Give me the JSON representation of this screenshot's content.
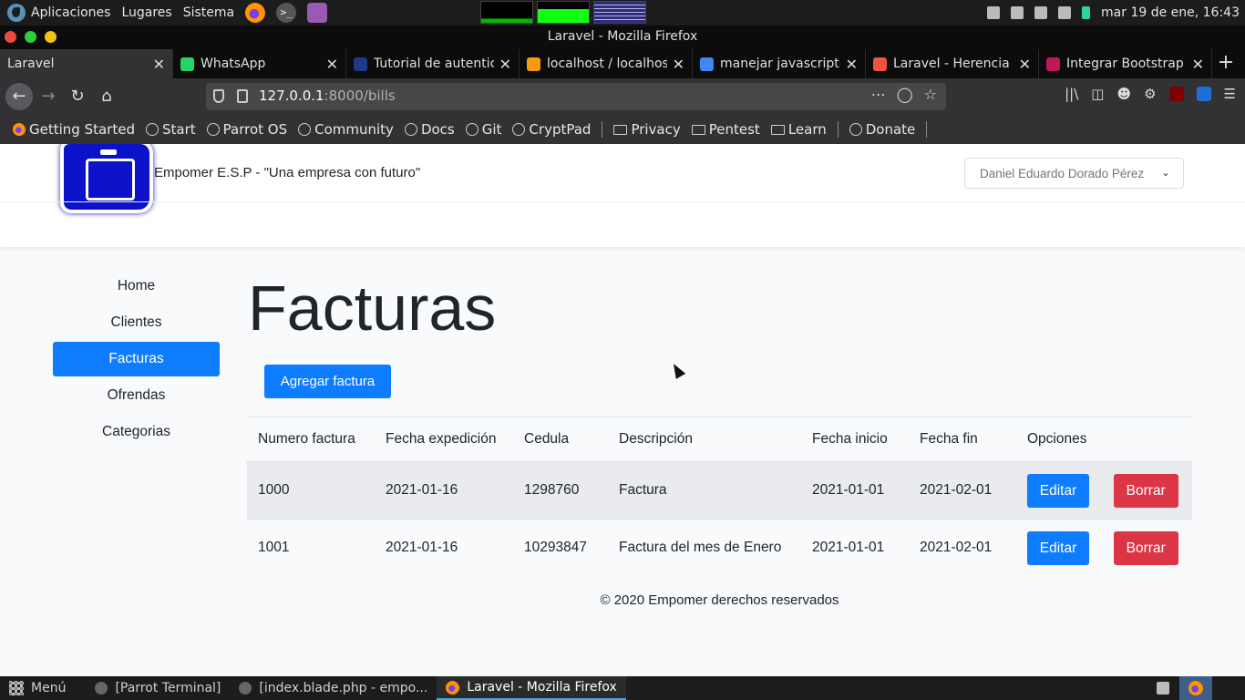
{
  "system_panel": {
    "menu_apps": "Aplicaciones",
    "menu_places": "Lugares",
    "menu_system": "Sistema",
    "clock": "mar 19 de ene, 16:43"
  },
  "window": {
    "title": "Laravel - Mozilla Firefox"
  },
  "tabs": [
    {
      "label": "Laravel",
      "icon": "no-favicon",
      "active": true
    },
    {
      "label": "WhatsApp",
      "icon": "whatsapp-icon",
      "color": "#25d366"
    },
    {
      "label": "Tutorial de autentic",
      "icon": "rocket-icon",
      "color": "#1e3a8a"
    },
    {
      "label": "localhost / localhost",
      "icon": "phpmyadmin-icon",
      "color": "#f89c0e"
    },
    {
      "label": "manejar javascript y",
      "icon": "google-icon",
      "color": "#4285f4"
    },
    {
      "label": "Laravel - Herencia d",
      "icon": "laravel-icon",
      "color": "#f05340"
    },
    {
      "label": "Integrar Bootstrap c",
      "icon": "bootstrap-icon",
      "color": "#c2185b"
    }
  ],
  "urlbar": {
    "host": "127.0.0.1",
    "path": ":8000/bills"
  },
  "bookmarks": [
    {
      "label": "Getting Started",
      "icon": "firefox-icon"
    },
    {
      "label": "Start",
      "icon": "globe-icon"
    },
    {
      "label": "Parrot OS",
      "icon": "globe-icon"
    },
    {
      "label": "Community",
      "icon": "globe-icon"
    },
    {
      "label": "Docs",
      "icon": "globe-icon"
    },
    {
      "label": "Git",
      "icon": "globe-icon"
    },
    {
      "label": "CryptPad",
      "icon": "globe-icon"
    },
    {
      "label": "Privacy",
      "icon": "folder-icon"
    },
    {
      "label": "Pentest",
      "icon": "folder-icon"
    },
    {
      "label": "Learn",
      "icon": "folder-icon"
    },
    {
      "label": "Donate",
      "icon": "globe-icon"
    }
  ],
  "header": {
    "brand": "Empomer E.S.P - \"Una empresa con futuro\"",
    "user_name": "Daniel Eduardo Dorado Pérez"
  },
  "sidebar": {
    "items": [
      {
        "label": "Home"
      },
      {
        "label": "Clientes"
      },
      {
        "label": "Facturas",
        "active": true
      },
      {
        "label": "Ofrendas"
      },
      {
        "label": "Categorias"
      }
    ]
  },
  "main": {
    "title": "Facturas",
    "add_button": "Agregar factura",
    "columns": [
      "Numero factura",
      "Fecha expedición",
      "Cedula",
      "Descripción",
      "Fecha inicio",
      "Fecha fin",
      "Opciones"
    ],
    "rows": [
      {
        "numero": "1000",
        "fecha_exp": "2021-01-16",
        "cedula": "1298760",
        "descripcion": "Factura",
        "inicio": "2021-01-01",
        "fin": "2021-02-01"
      },
      {
        "numero": "1001",
        "fecha_exp": "2021-01-16",
        "cedula": "10293847",
        "descripcion": "Factura del mes de Enero",
        "inicio": "2021-01-01",
        "fin": "2021-02-01"
      }
    ],
    "edit_label": "Editar",
    "delete_label": "Borrar"
  },
  "footer": {
    "text": "© 2020 Empomer derechos reservados"
  },
  "taskbar": {
    "menu": "Menú",
    "tasks": [
      {
        "label": "[Parrot Terminal]"
      },
      {
        "label": "[index.blade.php - empo..."
      },
      {
        "label": "Laravel - Mozilla Firefox",
        "active": true
      }
    ]
  },
  "colors": {
    "primary": "#0d7cff",
    "danger": "#dc3545"
  }
}
